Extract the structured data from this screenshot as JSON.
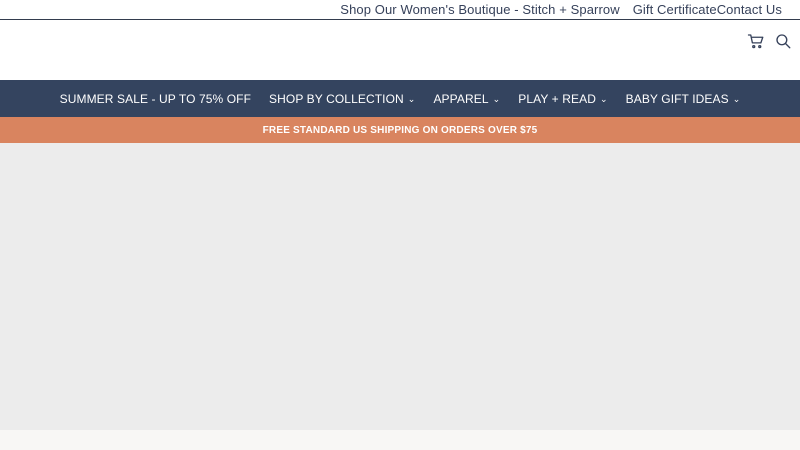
{
  "utility": {
    "links": [
      {
        "label": "Shop Our Women's Boutique - Stitch + Sparrow"
      },
      {
        "label": "Gift Certificate"
      },
      {
        "label": "Contact Us"
      }
    ]
  },
  "header": {
    "icons": [
      "cart-icon",
      "search-icon"
    ]
  },
  "nav": {
    "items": [
      {
        "label": "SUMMER SALE - UP TO 75% OFF",
        "dropdown": false
      },
      {
        "label": "SHOP BY COLLECTION",
        "dropdown": true
      },
      {
        "label": "APPAREL",
        "dropdown": true
      },
      {
        "label": "PLAY + READ",
        "dropdown": true
      },
      {
        "label": "BABY GIFT IDEAS",
        "dropdown": true
      }
    ],
    "chevron": "⌄"
  },
  "promo": {
    "text": "FREE STANDARD US SHIPPING ON ORDERS OVER $75"
  },
  "colors": {
    "nav_bg": "#34445f",
    "promo_bg": "#d9845f",
    "hero_bg": "#ececec"
  }
}
